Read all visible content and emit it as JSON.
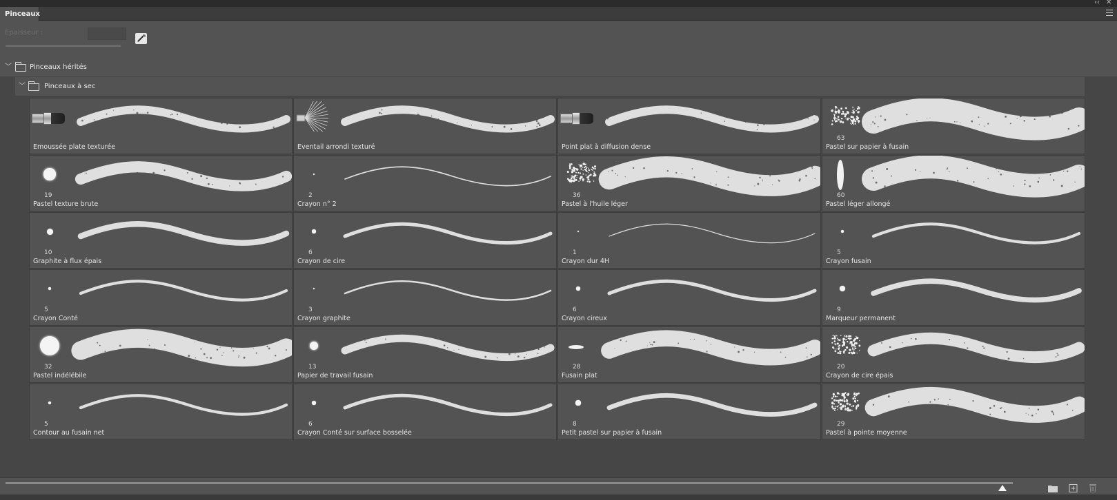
{
  "window": {
    "collapse_glyph": "‹‹",
    "close_glyph": "✕"
  },
  "panel": {
    "tab_label": "Pinceaux",
    "menu_icon": "hamburger-menu-icon"
  },
  "settings": {
    "thickness_label": "Epaisseur :",
    "thickness_value": "",
    "pressure_icon": "pressure-size-icon"
  },
  "groups": {
    "parent": {
      "label": "Pinceaux hérités",
      "expanded": true
    },
    "child": {
      "label": "Pinceaux à sec",
      "expanded": true
    }
  },
  "brushes": [
    {
      "name": "Emoussée plate texturée",
      "size": "",
      "tip": "flat-brush-icon"
    },
    {
      "name": "Eventail arrondi texturé",
      "size": "",
      "tip": "fan-brush-icon"
    },
    {
      "name": "Point plat à diffusion dense",
      "size": "",
      "tip": "flat-brush-icon"
    },
    {
      "name": "Pastel sur papier à fusain",
      "size": "63",
      "tip": "scatter-tip-icon"
    },
    {
      "name": "Pastel texture brute",
      "size": "19",
      "tip": "round-tip"
    },
    {
      "name": "Crayon n° 2",
      "size": "2",
      "tip": "round-tip"
    },
    {
      "name": "Pastel à l'huile léger",
      "size": "36",
      "tip": "scatter-tip-icon"
    },
    {
      "name": "Pastel léger allongé",
      "size": "60",
      "tip": "elliptical-tip"
    },
    {
      "name": "Graphite à flux épais",
      "size": "10",
      "tip": "round-tip"
    },
    {
      "name": "Crayon de cire",
      "size": "6",
      "tip": "round-tip"
    },
    {
      "name": "Crayon dur 4H",
      "size": "1",
      "tip": "round-tip"
    },
    {
      "name": "Crayon fusain",
      "size": "5",
      "tip": "round-tip"
    },
    {
      "name": "Crayon Conté",
      "size": "5",
      "tip": "round-tip"
    },
    {
      "name": "Crayon graphite",
      "size": "3",
      "tip": "round-tip"
    },
    {
      "name": "Crayon cireux",
      "size": "6",
      "tip": "round-tip"
    },
    {
      "name": "Marqueur permanent",
      "size": "9",
      "tip": "round-tip"
    },
    {
      "name": "Pastel indélébile",
      "size": "32",
      "tip": "round-tip"
    },
    {
      "name": "Papier de travail fusain",
      "size": "13",
      "tip": "round-tip"
    },
    {
      "name": "Fusain plat",
      "size": "28",
      "tip": "elliptical-tip"
    },
    {
      "name": "Crayon de cire épais",
      "size": "20",
      "tip": "scatter-tip-icon"
    },
    {
      "name": "Contour au fusain net",
      "size": "5",
      "tip": "round-tip"
    },
    {
      "name": "Crayon Conté sur surface bosselée",
      "size": "6",
      "tip": "round-tip"
    },
    {
      "name": "Petit pastel sur papier à fusain",
      "size": "8",
      "tip": "round-tip"
    },
    {
      "name": "Pastel à pointe moyenne",
      "size": "29",
      "tip": "square-texture-tip"
    }
  ],
  "footer": {
    "preview_size_level": 0.99,
    "new_group_icon": "folder-icon",
    "new_brush_icon": "new-brush-icon",
    "delete_icon": "trash-icon"
  }
}
